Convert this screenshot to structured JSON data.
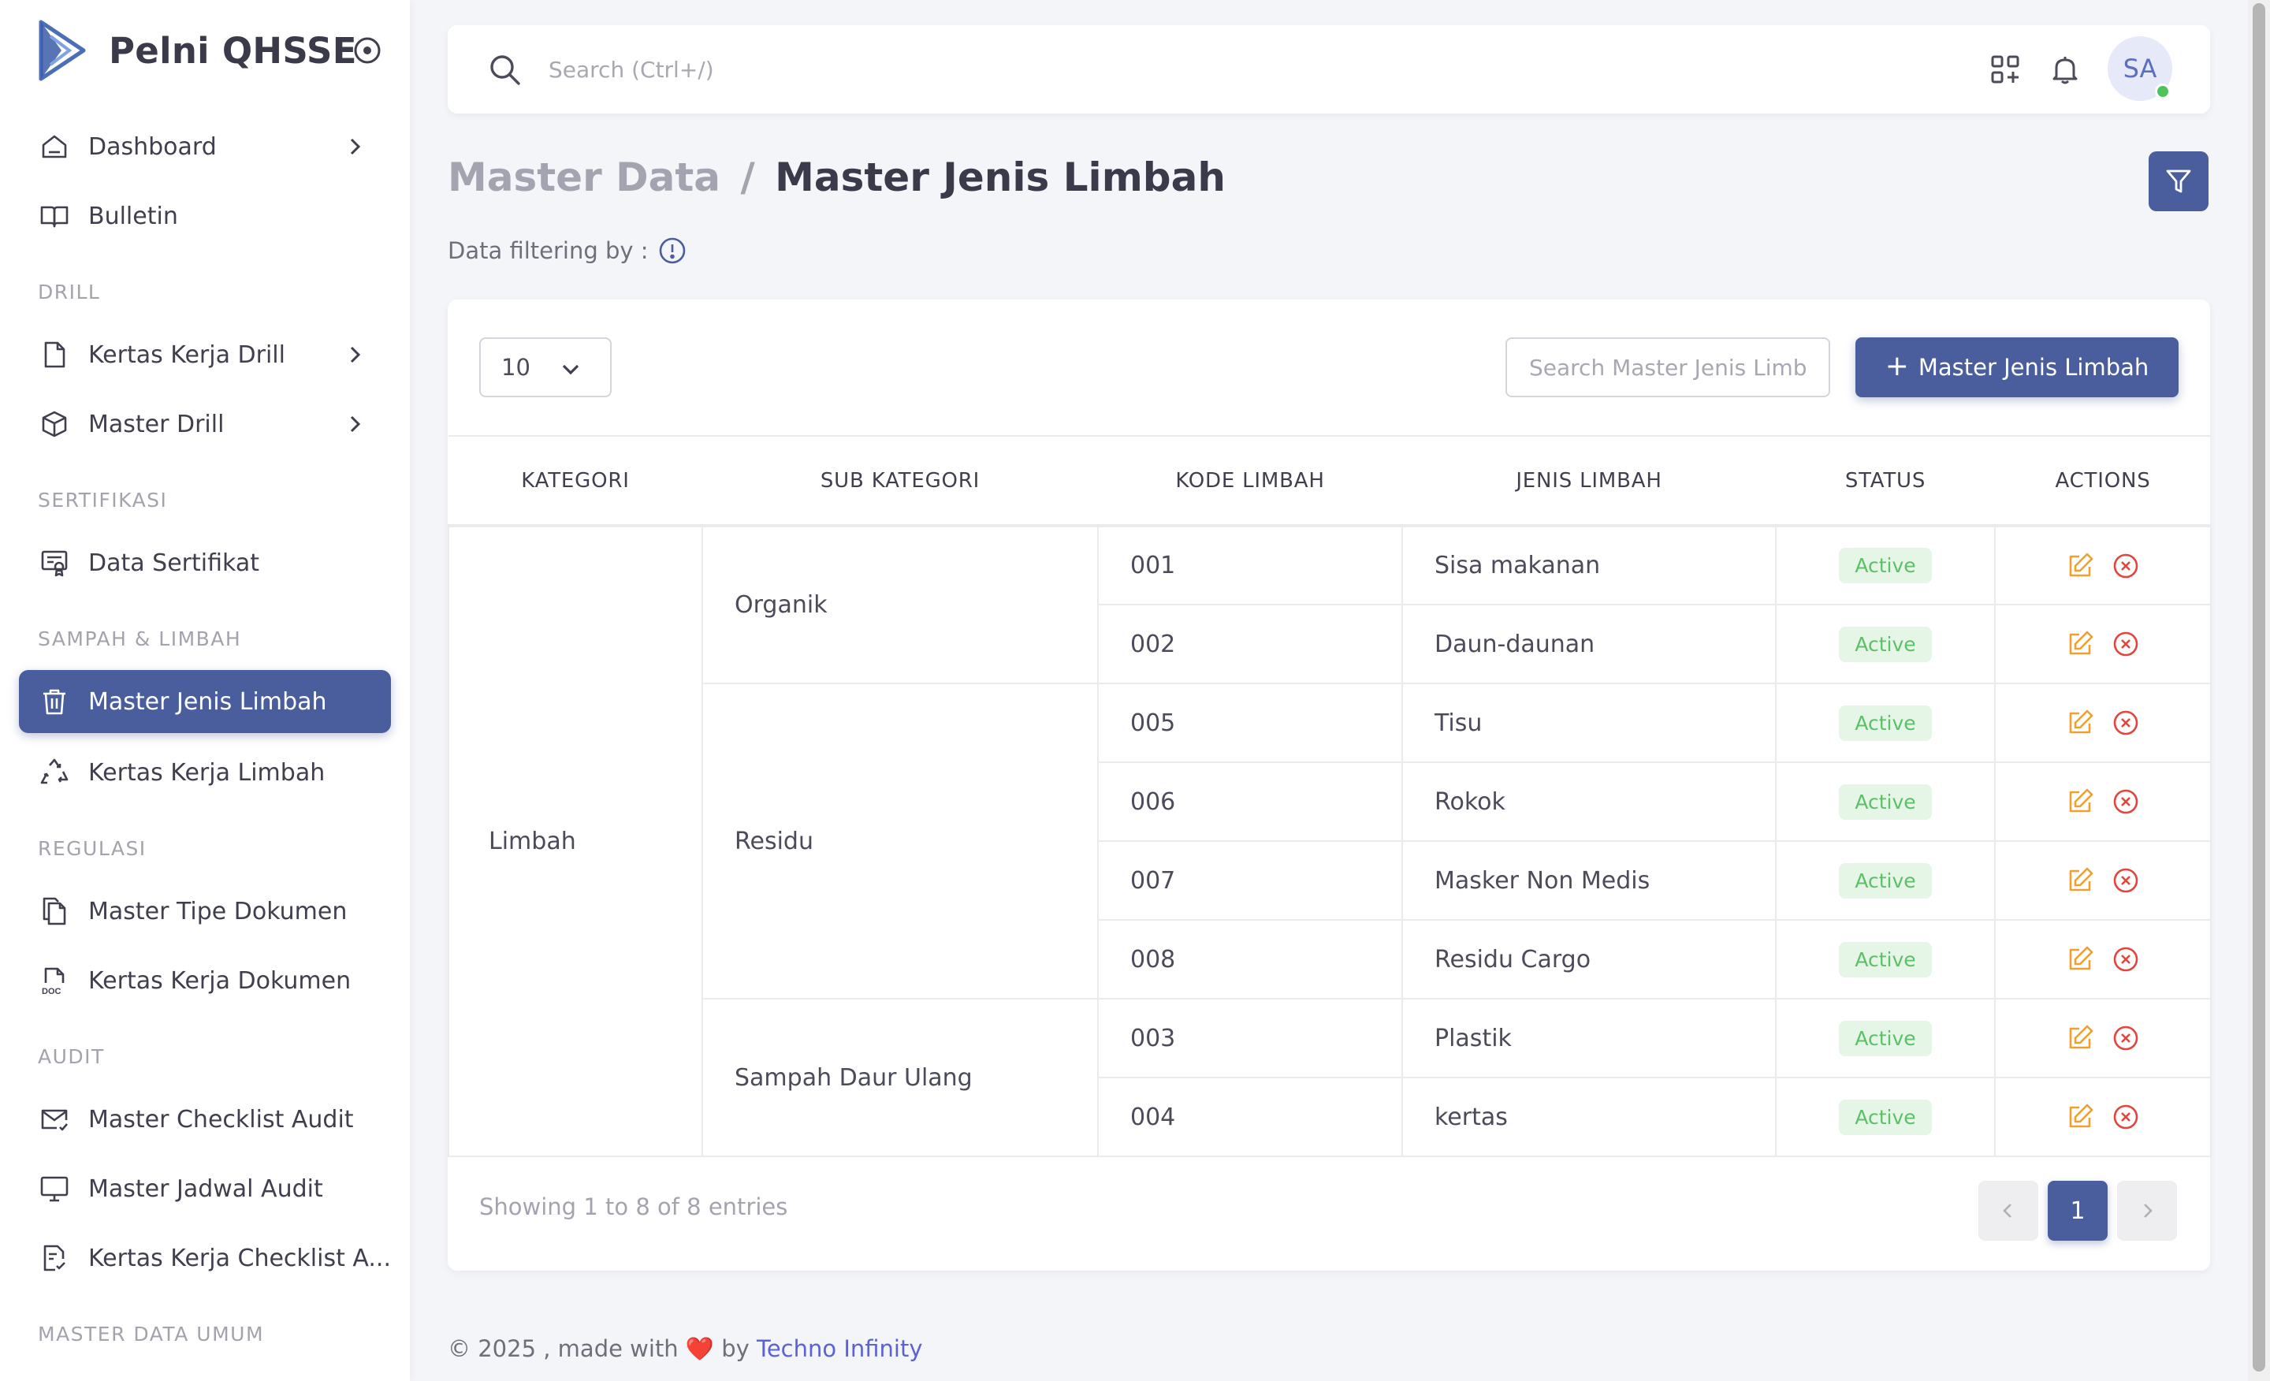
{
  "app": {
    "name": "Pelni QHSSE"
  },
  "sidebar": {
    "items": [
      {
        "label": "Dashboard"
      },
      {
        "label": "Bulletin"
      },
      {
        "section": "DRILL"
      },
      {
        "label": "Kertas Kerja Drill"
      },
      {
        "label": "Master Drill"
      },
      {
        "section": "SERTIFIKASI"
      },
      {
        "label": "Data Sertifikat"
      },
      {
        "section": "SAMPAH & LIMBAH"
      },
      {
        "label": "Master Jenis Limbah"
      },
      {
        "label": "Kertas Kerja Limbah"
      },
      {
        "section": "REGULASI"
      },
      {
        "label": "Master Tipe Dokumen"
      },
      {
        "label": "Kertas Kerja Dokumen"
      },
      {
        "section": "AUDIT"
      },
      {
        "label": "Master Checklist Audit"
      },
      {
        "label": "Master Jadwal Audit"
      },
      {
        "label": "Kertas Kerja Checklist A..."
      },
      {
        "section": "MASTER DATA UMUM"
      }
    ],
    "active": "Master Jenis Limbah"
  },
  "topbar": {
    "search_placeholder": "Search (Ctrl+/)",
    "avatar_initials": "SA"
  },
  "header": {
    "breadcrumb_parent": "Master Data",
    "breadcrumb_sep": "/",
    "title": "Master Jenis Limbah",
    "filter_note": "Data filtering by :"
  },
  "toolbar": {
    "page_size": "10",
    "search_placeholder": "Search Master Jenis Limbah",
    "add_label": "Master Jenis Limbah"
  },
  "table": {
    "columns": [
      "KATEGORI",
      "SUB KATEGORI",
      "KODE LIMBAH",
      "JENIS LIMBAH",
      "STATUS",
      "ACTIONS"
    ],
    "kategori": "Limbah",
    "subgroups": [
      "Organik",
      "Residu",
      "Sampah Daur Ulang"
    ],
    "rows": [
      {
        "kode": "001",
        "jenis": "Sisa makanan",
        "status": "Active"
      },
      {
        "kode": "002",
        "jenis": "Daun-daunan",
        "status": "Active"
      },
      {
        "kode": "005",
        "jenis": "Tisu",
        "status": "Active"
      },
      {
        "kode": "006",
        "jenis": "Rokok",
        "status": "Active"
      },
      {
        "kode": "007",
        "jenis": "Masker Non Medis",
        "status": "Active"
      },
      {
        "kode": "008",
        "jenis": "Residu Cargo",
        "status": "Active"
      },
      {
        "kode": "003",
        "jenis": "Plastik",
        "status": "Active"
      },
      {
        "kode": "004",
        "jenis": "kertas",
        "status": "Active"
      }
    ]
  },
  "pagination": {
    "info": "Showing 1 to 8 of 8 entries",
    "current_page": "1"
  },
  "footer": {
    "prefix": "© 2025 , made with",
    "heart": "❤️",
    "by": "by",
    "company": "Techno Infinity"
  },
  "colors": {
    "primary": "#4a5d9c",
    "status_active_bg": "#e5f6e6",
    "status_active_text": "#5cc068",
    "edit_icon": "#f0a030",
    "delete_icon": "#e2453b",
    "link": "#5b62d6"
  },
  "icons": {
    "brand": "pelni-logo",
    "sidebar": [
      "home-icon",
      "book-icon",
      "file-icon",
      "cube-icon",
      "certificate-icon",
      "trash-icon",
      "recycle-icon",
      "files-icon",
      "doc-file-icon",
      "mail-icon",
      "monitor-icon",
      "checklist-icon"
    ]
  }
}
